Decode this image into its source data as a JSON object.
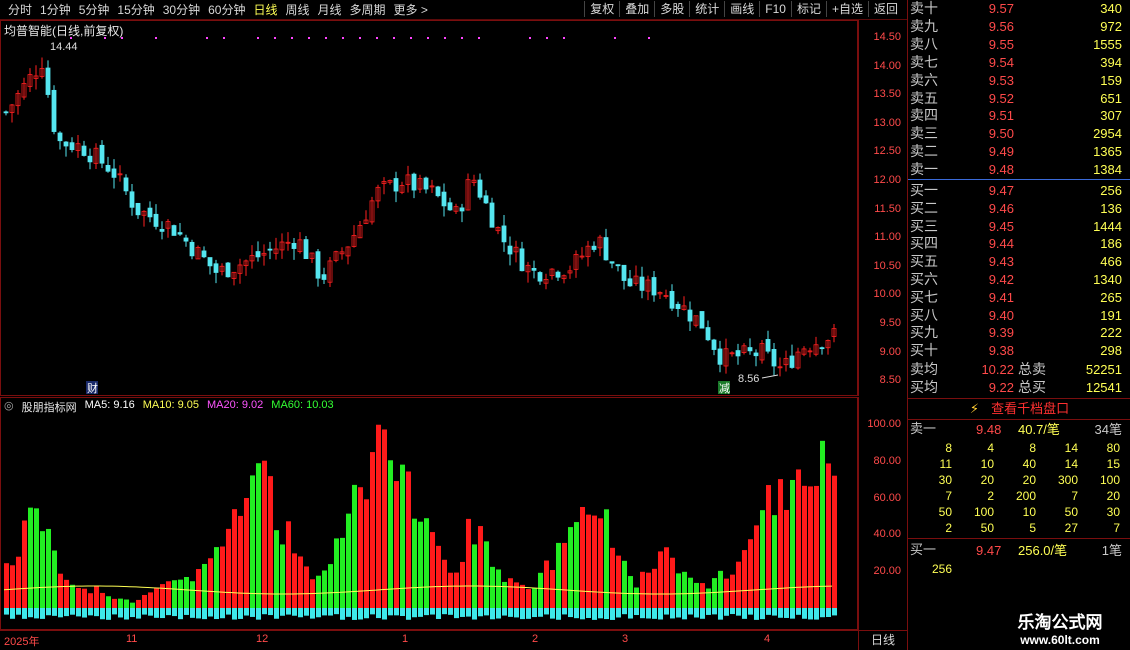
{
  "toolbar": {
    "periods": [
      "分时",
      "1分钟",
      "5分钟",
      "15分钟",
      "30分钟",
      "60分钟",
      "日线",
      "周线",
      "月线",
      "多周期",
      "更多 >"
    ],
    "active_period": "日线",
    "tools": [
      "复权",
      "叠加",
      "多股",
      "统计",
      "画线",
      "F10",
      "标记",
      "+自选",
      "返回"
    ]
  },
  "stock": {
    "title": "均普智能(日线,前复权)",
    "high_label": "14.44",
    "low_label": "8.56",
    "tag_cai": "财",
    "tag_jian": "减"
  },
  "price_axis": [
    "14.50",
    "14.00",
    "13.50",
    "13.00",
    "12.50",
    "12.00",
    "11.50",
    "11.00",
    "10.50",
    "10.00",
    "9.50",
    "9.00",
    "8.50"
  ],
  "indicator": {
    "name": "股朋指标网",
    "ma5": "MA5: 9.16",
    "ma10": "MA10: 9.05",
    "ma20": "MA20: 9.02",
    "ma60": "MA60: 10.03",
    "axis": [
      "100.00",
      "80.00",
      "60.00",
      "40.00",
      "20.00"
    ]
  },
  "time_axis": [
    "2025年",
    "11",
    "12",
    "1",
    "2",
    "3",
    "4"
  ],
  "period_label": "日线",
  "colors": {
    "up": "#ff2020",
    "down": "#55e6f0",
    "ind_up": "#ff1a1a",
    "ind_down": "#22ee22",
    "ind_base": "#3ee8ea",
    "ind_neg": "#ff33ff",
    "ma5": "#ffffff",
    "ma10": "#ffff55",
    "ma20": "#ff55ff",
    "ma60": "#33ff33"
  },
  "orderbook": {
    "sells": [
      {
        "label": "卖十",
        "price": "9.57",
        "vol": "340"
      },
      {
        "label": "卖九",
        "price": "9.56",
        "vol": "972"
      },
      {
        "label": "卖八",
        "price": "9.55",
        "vol": "1555"
      },
      {
        "label": "卖七",
        "price": "9.54",
        "vol": "394"
      },
      {
        "label": "卖六",
        "price": "9.53",
        "vol": "159"
      },
      {
        "label": "卖五",
        "price": "9.52",
        "vol": "651"
      },
      {
        "label": "卖四",
        "price": "9.51",
        "vol": "307"
      },
      {
        "label": "卖三",
        "price": "9.50",
        "vol": "2954"
      },
      {
        "label": "卖二",
        "price": "9.49",
        "vol": "1365"
      },
      {
        "label": "卖一",
        "price": "9.48",
        "vol": "1384"
      }
    ],
    "buys": [
      {
        "label": "买一",
        "price": "9.47",
        "vol": "256"
      },
      {
        "label": "买二",
        "price": "9.46",
        "vol": "136"
      },
      {
        "label": "买三",
        "price": "9.45",
        "vol": "1444"
      },
      {
        "label": "买四",
        "price": "9.44",
        "vol": "186"
      },
      {
        "label": "买五",
        "price": "9.43",
        "vol": "466"
      },
      {
        "label": "买六",
        "price": "9.42",
        "vol": "1340"
      },
      {
        "label": "买七",
        "price": "9.41",
        "vol": "265"
      },
      {
        "label": "买八",
        "price": "9.40",
        "vol": "191"
      },
      {
        "label": "买九",
        "price": "9.39",
        "vol": "222"
      },
      {
        "label": "买十",
        "price": "9.38",
        "vol": "298"
      }
    ],
    "avg_sell": {
      "label": "卖均",
      "price": "10.22",
      "total_label": "总卖",
      "total": "52251"
    },
    "avg_buy": {
      "label": "买均",
      "price": "9.22",
      "total_label": "总买",
      "total": "12541"
    }
  },
  "depth_button": "查看千档盘口",
  "queue_sell": {
    "label": "卖一",
    "price": "9.48",
    "avg": "40.7/笔",
    "count": "34笔",
    "rows": [
      [
        "8",
        "4",
        "8",
        "14",
        "80"
      ],
      [
        "11",
        "10",
        "40",
        "14",
        "15"
      ],
      [
        "30",
        "20",
        "20",
        "300",
        "100"
      ],
      [
        "7",
        "2",
        "200",
        "7",
        "20"
      ],
      [
        "50",
        "100",
        "10",
        "50",
        "30"
      ],
      [
        "2",
        "50",
        "5",
        "27",
        "7"
      ]
    ]
  },
  "queue_buy": {
    "label": "买一",
    "price": "9.47",
    "avg": "256.0/笔",
    "count": "1笔",
    "rows": [
      [
        "256"
      ]
    ]
  },
  "watermark": {
    "line1": "乐淘公式网",
    "line2": "www.60lt.com"
  }
}
